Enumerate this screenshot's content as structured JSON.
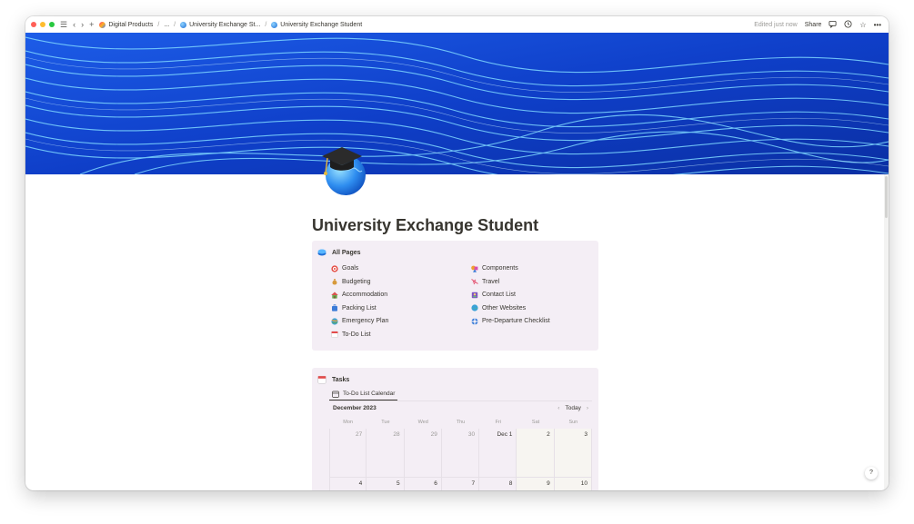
{
  "topbar": {
    "breadcrumbs": [
      {
        "label": "Digital Products",
        "icon": "gradient-logo-icon"
      },
      {
        "label": "..."
      },
      {
        "label": "University Exchange St...",
        "icon": "globe-icon"
      },
      {
        "label": "University Exchange Student",
        "icon": "globe-icon"
      }
    ],
    "edited": "Edited just now",
    "share": "Share"
  },
  "page": {
    "title": "University Exchange Student",
    "icon": "graduation-cap-globe-icon"
  },
  "all_pages": {
    "heading": "All Pages",
    "left": [
      {
        "label": "Goals",
        "icon": "target-icon",
        "color": "#e3453b"
      },
      {
        "label": "Budgeting",
        "icon": "money-bag-icon",
        "color": "#d79a3b"
      },
      {
        "label": "Accommodation",
        "icon": "house-icon",
        "color": "#6aa84f"
      },
      {
        "label": "Packing List",
        "icon": "suitcase-icon",
        "color": "#3b7bd7"
      },
      {
        "label": "Emergency Plan",
        "icon": "globe-icon",
        "color": "#e6a23c"
      },
      {
        "label": "To-Do List",
        "icon": "calendar-icon",
        "color": "#e34b4b"
      }
    ],
    "right": [
      {
        "label": "Components",
        "icon": "shapes-icon",
        "color": "#d94fb0"
      },
      {
        "label": "Travel",
        "icon": "airplane-icon",
        "color": "#e34b6b"
      },
      {
        "label": "Contact List",
        "icon": "contact-card-icon",
        "color": "#7e57c2"
      },
      {
        "label": "Other Websites",
        "icon": "globe-icon",
        "color": "#3ba2d7"
      },
      {
        "label": "Pre-Departure Checklist",
        "icon": "lifebuoy-icon",
        "color": "#3b7bd7"
      }
    ]
  },
  "tasks": {
    "heading": "Tasks",
    "view_tab": "To-Do List Calendar",
    "month": "December 2023",
    "today": "Today",
    "weekdays": [
      "Mon",
      "Tue",
      "Wed",
      "Thu",
      "Fri",
      "Sat",
      "Sun"
    ],
    "week1": [
      "27",
      "28",
      "29",
      "30",
      "Dec 1",
      "2",
      "3"
    ],
    "week2": [
      "4",
      "5",
      "6",
      "7",
      "8",
      "9",
      "10"
    ]
  },
  "help": "?"
}
